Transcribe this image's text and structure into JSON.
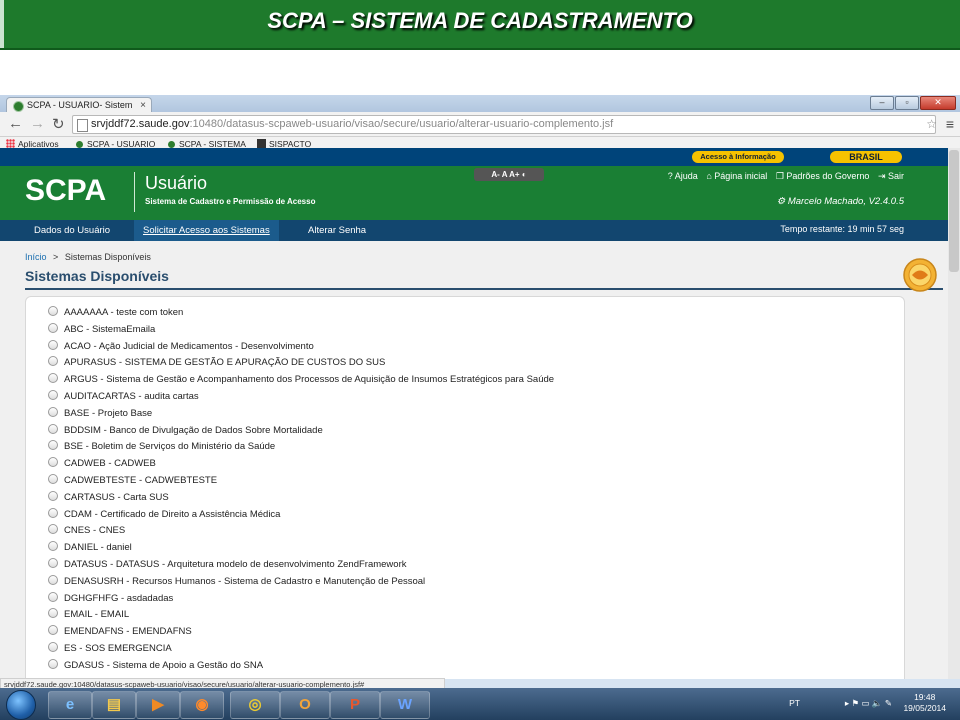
{
  "slide": {
    "title": "SCPA – SISTEMA DE CADASTRAMENTO"
  },
  "browser": {
    "tab_title": "SCPA - USUARIO- Sistema",
    "url_host": "srvjddf72.saude.gov",
    "url_path": ":10480/datasus-scpaweb-usuario/visao/secure/usuario/alterar-usuario-complemento.jsf",
    "bookmarks": [
      "Aplicativos",
      "SCPA - USUARIO",
      "SCPA - SISTEMA",
      "SISPACTO"
    ],
    "status_url": "srvjddf72.saude.gov:10480/datasus-scpaweb-usuario/visao/secure/usuario/alterar-usuario-complemento.jsf#"
  },
  "gov_bar": {
    "info_button": "Acesso à Informação",
    "brasil_button": "BRASIL"
  },
  "header": {
    "logo": "SCPA",
    "module": "Usuário",
    "subtitle": "Sistema de Cadastro e Permissão de Acesso",
    "font_controls": "A-  A  A+  ◐",
    "links": [
      "? Ajuda",
      "⌂ Página inicial",
      "❐ Padrões do Governo",
      "⇥ Sair"
    ],
    "user": "Marcelo Machado, V2.4.0.5"
  },
  "nav": {
    "items": [
      "Dados do Usuário",
      "Solicitar Acesso aos Sistemas",
      "Alterar Senha"
    ],
    "time_left": "Tempo restante: 19 min 57 seg"
  },
  "breadcrumb": {
    "home": "Início",
    "separator": ">",
    "current": "Sistemas Disponíveis"
  },
  "page_title": "Sistemas Disponíveis",
  "systems": [
    "AAAAAAA - teste com token",
    "ABC - SistemaEmaila",
    "ACAO - Ação Judicial de Medicamentos - Desenvolvimento",
    "APURASUS - SISTEMA DE GESTÃO E APURAÇÃO DE CUSTOS DO SUS",
    "ARGUS - Sistema de Gestão e Acompanhamento dos Processos de Aquisição de Insumos Estratégicos para Saúde",
    "AUDITACARTAS - audita cartas",
    "BASE - Projeto Base",
    "BDDSIM - Banco de Divulgação de Dados Sobre Mortalidade",
    "BSE - Boletim de Serviços do Ministério da Saúde",
    "CADWEB - CADWEB",
    "CADWEBTESTE - CADWEBTESTE",
    "CARTASUS - Carta SUS",
    "CDAM - Certificado de Direito a Assistência Médica",
    "CNES - CNES",
    "DANIEL - daniel",
    "DATASUS - DATASUS - Arquitetura modelo de desenvolvimento ZendFramework",
    "DENASUSRH - Recursos Humanos - Sistema de Cadastro e Manutenção de Pessoal",
    "DGHGFHFG - asdadadas",
    "EMAIL - EMAIL",
    "EMENDAFNS - EMENDAFNS",
    "ES - SOS EMERGENCIA",
    "GDASUS - Sistema de Apoio a Gestão do SNA"
  ],
  "taskbar": {
    "lang": "PT",
    "time": "19:48",
    "date": "19/05/2014",
    "tray_icons": "▸ ⚑ ▭ 🔈 ✎"
  }
}
